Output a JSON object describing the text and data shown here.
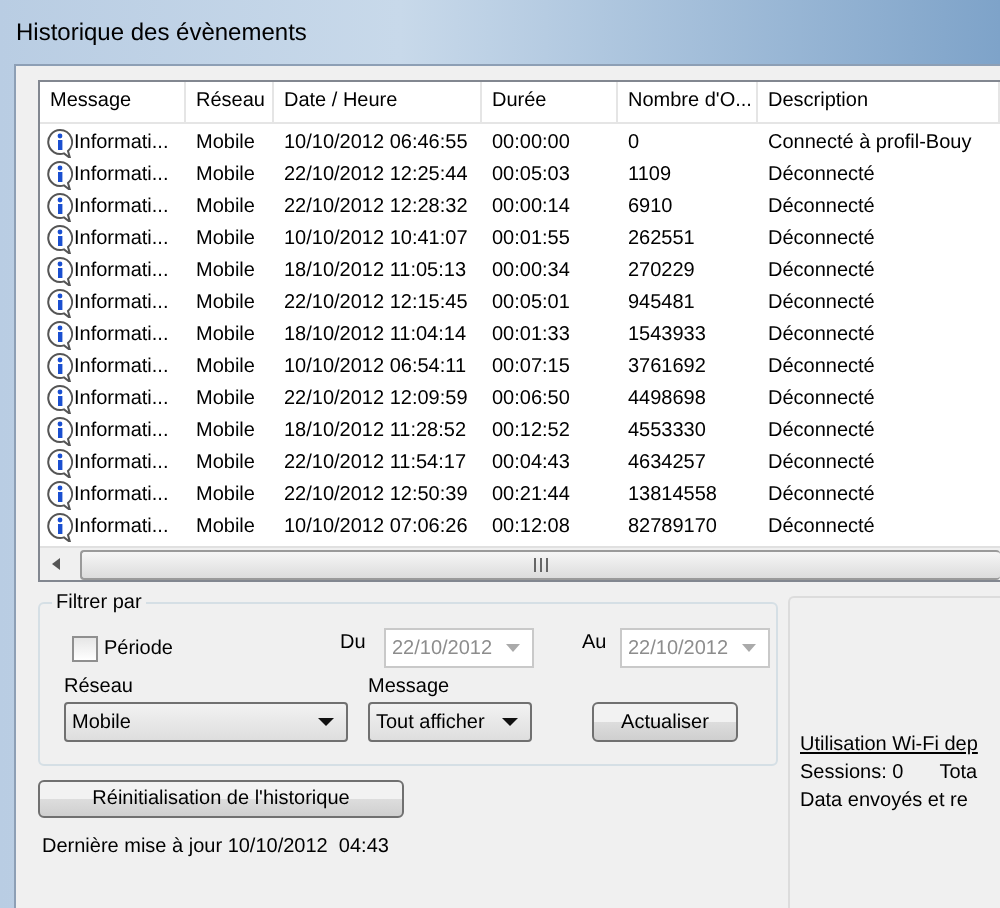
{
  "window": {
    "title": "Historique des évènements"
  },
  "table": {
    "columns": [
      "Message",
      "Réseau",
      "Date / Heure",
      "Durée",
      "Nombre d'O...",
      "Description"
    ],
    "rows": [
      {
        "message": "Informati...",
        "network": "Mobile",
        "datetime": "10/10/2012 06:46:55",
        "duration": "00:00:00",
        "count": "0",
        "description": "Connecté à profil-Bouy"
      },
      {
        "message": "Informati...",
        "network": "Mobile",
        "datetime": "22/10/2012 12:25:44",
        "duration": "00:05:03",
        "count": "1109",
        "description": "Déconnecté"
      },
      {
        "message": "Informati...",
        "network": "Mobile",
        "datetime": "22/10/2012 12:28:32",
        "duration": "00:00:14",
        "count": "6910",
        "description": "Déconnecté"
      },
      {
        "message": "Informati...",
        "network": "Mobile",
        "datetime": "10/10/2012 10:41:07",
        "duration": "00:01:55",
        "count": "262551",
        "description": "Déconnecté"
      },
      {
        "message": "Informati...",
        "network": "Mobile",
        "datetime": "18/10/2012 11:05:13",
        "duration": "00:00:34",
        "count": "270229",
        "description": "Déconnecté"
      },
      {
        "message": "Informati...",
        "network": "Mobile",
        "datetime": "22/10/2012 12:15:45",
        "duration": "00:05:01",
        "count": "945481",
        "description": "Déconnecté"
      },
      {
        "message": "Informati...",
        "network": "Mobile",
        "datetime": "18/10/2012 11:04:14",
        "duration": "00:01:33",
        "count": "1543933",
        "description": "Déconnecté"
      },
      {
        "message": "Informati...",
        "network": "Mobile",
        "datetime": "10/10/2012 06:54:11",
        "duration": "00:07:15",
        "count": "3761692",
        "description": "Déconnecté"
      },
      {
        "message": "Informati...",
        "network": "Mobile",
        "datetime": "22/10/2012 12:09:59",
        "duration": "00:06:50",
        "count": "4498698",
        "description": "Déconnecté"
      },
      {
        "message": "Informati...",
        "network": "Mobile",
        "datetime": "18/10/2012 11:28:52",
        "duration": "00:12:52",
        "count": "4553330",
        "description": "Déconnecté"
      },
      {
        "message": "Informati...",
        "network": "Mobile",
        "datetime": "22/10/2012 11:54:17",
        "duration": "00:04:43",
        "count": "4634257",
        "description": "Déconnecté"
      },
      {
        "message": "Informati...",
        "network": "Mobile",
        "datetime": "22/10/2012 12:50:39",
        "duration": "00:21:44",
        "count": "13814558",
        "description": "Déconnecté"
      },
      {
        "message": "Informati...",
        "network": "Mobile",
        "datetime": "10/10/2012 07:06:26",
        "duration": "00:12:08",
        "count": "82789170",
        "description": "Déconnecté"
      }
    ]
  },
  "filter": {
    "title": "Filtrer par",
    "period": {
      "label": "Période",
      "checked": false
    },
    "from": {
      "label": "Du",
      "value": "22/10/2012",
      "disabled": true
    },
    "to": {
      "label": "Au",
      "value": "22/10/2012",
      "disabled": true
    },
    "network": {
      "label": "Réseau",
      "value": "Mobile"
    },
    "message": {
      "label": "Message",
      "value": "Tout afficher"
    },
    "refresh_button": "Actualiser"
  },
  "reset_button": "Réinitialisation de l'historique",
  "last_update": "Dernière mise à jour 10/10/2012  04:43",
  "wifi_panel": {
    "heading": "Utilisation Wi-Fi dep",
    "sessions": "Sessions: 0",
    "total": "Tota",
    "data": "Data envoyés et re"
  }
}
